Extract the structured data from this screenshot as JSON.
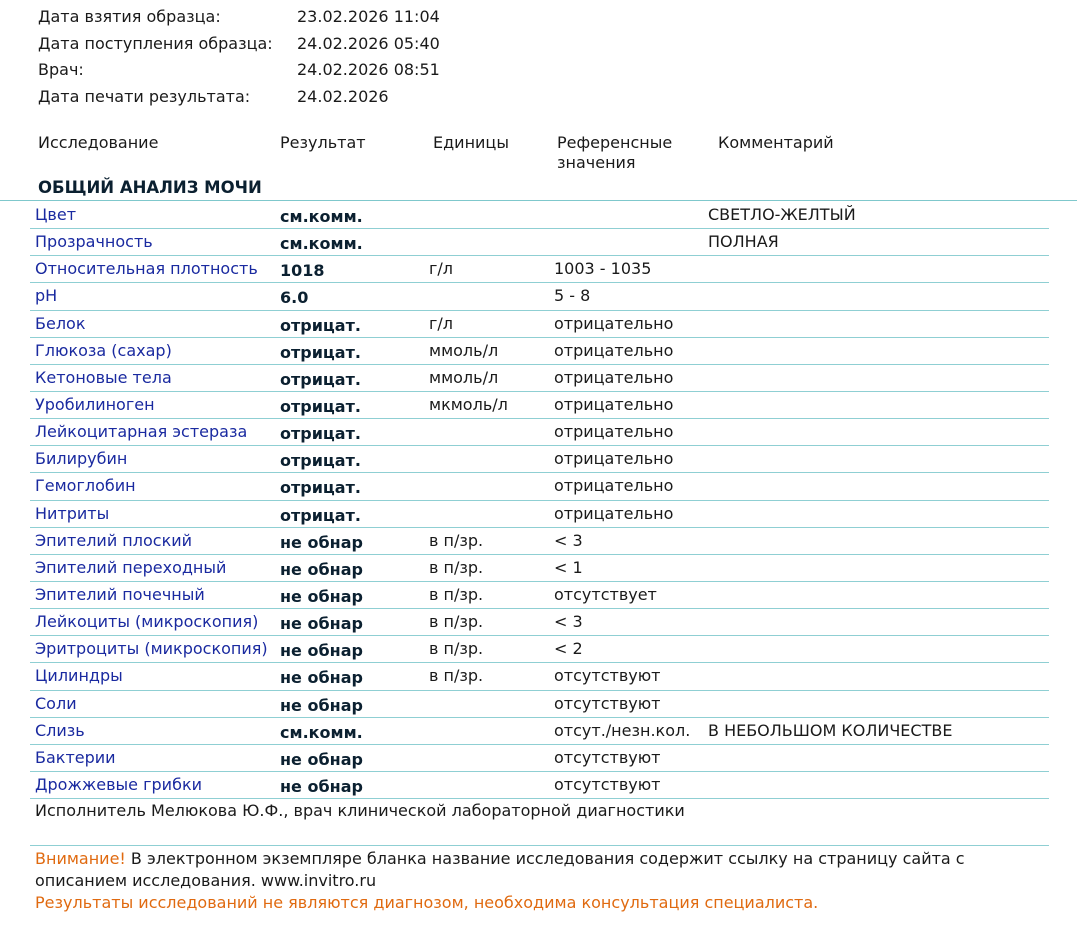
{
  "meta": [
    {
      "label": "Дата взятия образца:",
      "value": "23.02.2026 11:04"
    },
    {
      "label": "Дата поступления образца:",
      "value": "24.02.2026 05:40"
    },
    {
      "label": "Врач:",
      "value": "24.02.2026 08:51"
    },
    {
      "label": "Дата печати результата:",
      "value": "24.02.2026"
    }
  ],
  "headers": {
    "test": "Исследование",
    "result": "Результат",
    "units": "Единицы",
    "reference_line1": "Референсные",
    "reference_line2": "значения",
    "comment": "Комментарий"
  },
  "section_title": "ОБЩИЙ АНАЛИЗ МОЧИ",
  "rows": [
    {
      "name": "Цвет",
      "result": "см.комм.",
      "unit": "",
      "ref": "",
      "comment": "СВЕТЛО-ЖЕЛТЫЙ"
    },
    {
      "name": "Прозрачность",
      "result": "см.комм.",
      "unit": "",
      "ref": "",
      "comment": "ПОЛНАЯ"
    },
    {
      "name": "Относительная плотность",
      "result": "1018",
      "unit": "г/л",
      "ref": "1003 - 1035",
      "comment": ""
    },
    {
      "name": "pH",
      "result": "6.0",
      "unit": "",
      "ref": "5 - 8",
      "comment": ""
    },
    {
      "name": "Белок",
      "result": "отрицат.",
      "unit": "г/л",
      "ref": "отрицательно",
      "comment": ""
    },
    {
      "name": "Глюкоза (сахар)",
      "result": "отрицат.",
      "unit": "ммоль/л",
      "ref": "отрицательно",
      "comment": ""
    },
    {
      "name": "Кетоновые тела",
      "result": "отрицат.",
      "unit": "ммоль/л",
      "ref": "отрицательно",
      "comment": ""
    },
    {
      "name": "Уробилиноген",
      "result": "отрицат.",
      "unit": "мкмоль/л",
      "ref": "отрицательно",
      "comment": ""
    },
    {
      "name": "Лейкоцитарная эстераза",
      "result": "отрицат.",
      "unit": "",
      "ref": "отрицательно",
      "comment": ""
    },
    {
      "name": "Билирубин",
      "result": "отрицат.",
      "unit": "",
      "ref": "отрицательно",
      "comment": ""
    },
    {
      "name": "Гемоглобин",
      "result": "отрицат.",
      "unit": "",
      "ref": "отрицательно",
      "comment": ""
    },
    {
      "name": "Нитриты",
      "result": "отрицат.",
      "unit": "",
      "ref": "отрицательно",
      "comment": ""
    },
    {
      "name": "Эпителий плоский",
      "result": "не обнар",
      "unit": "в п/зр.",
      "ref": "< 3",
      "comment": ""
    },
    {
      "name": "Эпителий переходный",
      "result": "не обнар",
      "unit": "в п/зр.",
      "ref": "< 1",
      "comment": ""
    },
    {
      "name": "Эпителий почечный",
      "result": "не обнар",
      "unit": "в п/зр.",
      "ref": "отсутствует",
      "comment": ""
    },
    {
      "name": "Лейкоциты (микроскопия)",
      "result": "не обнар",
      "unit": "в п/зр.",
      "ref": "< 3",
      "comment": ""
    },
    {
      "name": "Эритроциты (микроскопия)",
      "result": "не обнар",
      "unit": "в п/зр.",
      "ref": "< 2",
      "comment": ""
    },
    {
      "name": "Цилиндры",
      "result": "не обнар",
      "unit": "в п/зр.",
      "ref": "отсутствуют",
      "comment": ""
    },
    {
      "name": "Соли",
      "result": "не обнар",
      "unit": "",
      "ref": "отсутствуют",
      "comment": ""
    },
    {
      "name": "Слизь",
      "result": "см.комм.",
      "unit": "",
      "ref": "отсут./незн.кол.",
      "comment": "В НЕБОЛЬШОМ КОЛИЧЕСТВЕ"
    },
    {
      "name": "Бактерии",
      "result": "не обнар",
      "unit": "",
      "ref": "отсутствуют",
      "comment": ""
    },
    {
      "name": "Дрожжевые грибки",
      "result": "не обнар",
      "unit": "",
      "ref": "отсутствуют",
      "comment": ""
    }
  ],
  "performer": "Исполнитель Мелюкова  Ю.Ф., врач клинической лабораторной диагностики",
  "notice": {
    "warning_label": "Внимание!",
    "text": " В электронном экземпляре бланка название исследования содержит ссылку на страницу сайта с описанием исследования. www.invitro.ru",
    "disclaimer": "Результаты исследований не являются диагнозом, необходима консультация специалиста."
  }
}
